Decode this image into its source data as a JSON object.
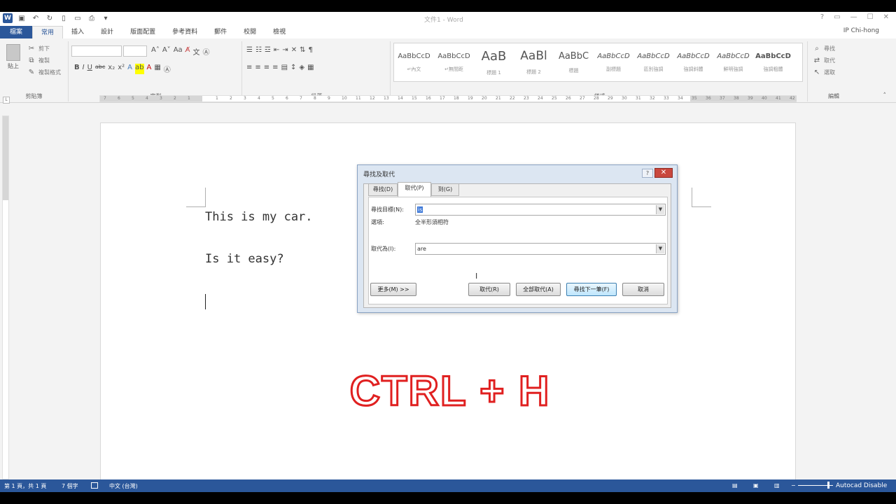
{
  "titlebar": {
    "doc_title": "文件1 - Word",
    "qat_icons": [
      "word-logo-icon",
      "save-icon",
      "undo-icon",
      "redo-icon",
      "new-icon",
      "open-icon",
      "print-icon",
      "customize-icon"
    ],
    "window_controls": [
      "?",
      "▭",
      "—",
      "☐",
      "✕"
    ]
  },
  "user": "IP Chi-hong",
  "tabs": [
    "檔案",
    "常用",
    "插入",
    "設計",
    "版面配置",
    "參考資料",
    "郵件",
    "校閱",
    "檢視"
  ],
  "ribbon": {
    "clipboard": {
      "paste": "貼上",
      "cut": "剪下",
      "copy": "複製",
      "format_painter": "複製格式",
      "label": "剪貼簿"
    },
    "font": {
      "label": "字型",
      "row2": [
        "B",
        "I",
        "U",
        "abc",
        "x₂",
        "x²",
        "A",
        "ab",
        "A",
        "▦",
        "Ⓐ"
      ]
    },
    "paragraph": {
      "label": "段落"
    },
    "styles": {
      "label": "樣式",
      "items": [
        {
          "sample": "AaBbCcD",
          "name": "↵內文",
          "size": 10
        },
        {
          "sample": "AaBbCcD",
          "name": "↵無間距",
          "size": 10
        },
        {
          "sample": "AaB",
          "name": "標題 1",
          "size": 18
        },
        {
          "sample": "AaBl",
          "name": "標題 2",
          "size": 17
        },
        {
          "sample": "AaBbC",
          "name": "標題",
          "size": 13
        },
        {
          "sample": "AaBbCcD",
          "name": "副標題",
          "size": 10
        },
        {
          "sample": "AaBbCcD",
          "name": "區別強調",
          "size": 10
        },
        {
          "sample": "AaBbCcD",
          "name": "強調斜體",
          "size": 10
        },
        {
          "sample": "AaBbCcD",
          "name": "鮮明強調",
          "size": 10
        },
        {
          "sample": "AaBbCcD",
          "name": "強調粗體",
          "size": 10
        }
      ]
    },
    "editing": {
      "find": "尋找",
      "replace": "取代",
      "select": "選取",
      "label": "編輯"
    }
  },
  "ruler": {
    "left_ticks": [
      "7",
      "6",
      "5",
      "4",
      "3",
      "2",
      "1"
    ],
    "right_ticks": [
      "1",
      "2",
      "3",
      "4",
      "5",
      "6",
      "7",
      "8",
      "9",
      "10",
      "11",
      "12",
      "13",
      "14",
      "15",
      "16",
      "17",
      "18",
      "19",
      "20",
      "21",
      "22",
      "23",
      "24",
      "25",
      "26",
      "27",
      "28",
      "29",
      "30",
      "31",
      "32",
      "33",
      "34",
      "35",
      "36",
      "37",
      "38",
      "39",
      "40",
      "41",
      "42"
    ]
  },
  "document": {
    "lines": [
      "This is my car.",
      "Is it easy?"
    ]
  },
  "overlay": {
    "text": "CTRL + H"
  },
  "dialog": {
    "title": "尋找及取代",
    "help": "?",
    "close": "✕",
    "tabs": [
      "尋找(D)",
      "取代(P)",
      "到(G)"
    ],
    "active_tab": 1,
    "find_label": "尋找目標(N):",
    "find_value": "is",
    "options_label": "選項:",
    "options_value": "全半形須相符",
    "replace_label": "取代為(I):",
    "replace_value": "are",
    "buttons": {
      "more": "更多(M) >>",
      "replace": "取代(R)",
      "replace_all": "全部取代(A)",
      "find_next": "尋找下一筆(F)",
      "cancel": "取消"
    }
  },
  "statusbar": {
    "page": "第 1 頁，共 1 頁",
    "words": "7 個字",
    "language": "中文 (台灣)",
    "trailing": "Autocad Disable"
  }
}
